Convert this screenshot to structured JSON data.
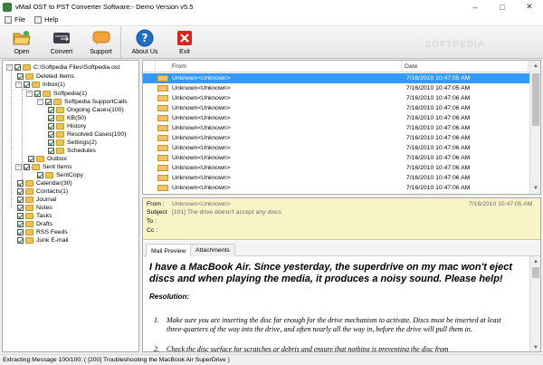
{
  "window": {
    "title": "vMail OST to PST Converter Software:- Demo Version v5.5"
  },
  "menu": [
    {
      "label": "File"
    },
    {
      "label": "Help"
    }
  ],
  "toolbar": {
    "open": "Open",
    "convert": "Convert",
    "support": "Support",
    "about": "About Us",
    "exit": "Exit"
  },
  "watermark": "SOFTPEDIA",
  "tree": {
    "root": "C:\\Softpedia Files\\Softpedia.ost",
    "deleted": "Deleted Items",
    "inbox": "Inbox(1)",
    "softpedia": "Softpedia(1)",
    "supportcalls": "Softpedia SupportCalls",
    "ongoing": "Ongoing Cases(100)",
    "kb": "KB(50)",
    "history": "History",
    "resolved": "Resolved Cases(100)",
    "settings": "Settings(2)",
    "schedules": "Schedules",
    "outbox": "Outbox",
    "sent": "Sent Items",
    "sentcopy": "SentCopy",
    "calendar": "Calendar(30)",
    "contacts": "Contacts(1)",
    "journal": "Journal",
    "notes": "Notes",
    "tasks": "Tasks",
    "drafts": "Drafts",
    "rss": "RSS Feeds",
    "junk": "Junk E-mail"
  },
  "grid": {
    "col_from": "From",
    "col_date": "Date",
    "rows": [
      {
        "from": "Unknown<Unknown>",
        "date": "7/16/2010 10:47:05 AM"
      },
      {
        "from": "Unknown<Unknown>",
        "date": "7/16/2010 10:47:05 AM"
      },
      {
        "from": "Unknown<Unknown>",
        "date": "7/16/2010 10:47:06 AM"
      },
      {
        "from": "Unknown<Unknown>",
        "date": "7/16/2010 10:47:06 AM"
      },
      {
        "from": "Unknown<Unknown>",
        "date": "7/16/2010 10:47:06 AM"
      },
      {
        "from": "Unknown<Unknown>",
        "date": "7/16/2010 10:47:06 AM"
      },
      {
        "from": "Unknown<Unknown>",
        "date": "7/16/2010 10:47:06 AM"
      },
      {
        "from": "Unknown<Unknown>",
        "date": "7/16/2010 10:47:06 AM"
      },
      {
        "from": "Unknown<Unknown>",
        "date": "7/16/2010 10:47:06 AM"
      },
      {
        "from": "Unknown<Unknown>",
        "date": "7/16/2010 10:47:06 AM"
      },
      {
        "from": "Unknown<Unknown>",
        "date": "7/16/2010 10:47:06 AM"
      },
      {
        "from": "Unknown<Unknown>",
        "date": "7/16/2010 10:47:06 AM"
      }
    ]
  },
  "preview": {
    "from_label": "From :",
    "from_value": "Unknown<Unknown>",
    "date": "7/16/2010 10:47:05 AM",
    "subject_label": "Subject :",
    "subject_value": "[101] The drive doesn't accept any discs",
    "to_label": "To :",
    "cc_label": "Cc :",
    "tab_mail": "Mail Preview",
    "tab_attach": "Attachments",
    "question": "I have a MacBook Air. Since yesterday, the superdrive on my mac won't eject discs and when playing the media, it produces a noisy sound. Please help!",
    "resolution": "Resolution:",
    "step1_num": "1.",
    "step1": "Make sure you are inserting the disc far enough for the drive mechanism to activate. Discs must be inserted at least three-quarters of the way into the drive, and often nearly all the way in, before the drive will pull them in.",
    "step2_num": "2.",
    "step2": "Check the disc surface for scratches or debris and ensure that nothing is preventing the disc from"
  },
  "status": "Extracting Message 100/100: ( [200] Troubleshooting the MacBook Air SuperDrive )"
}
